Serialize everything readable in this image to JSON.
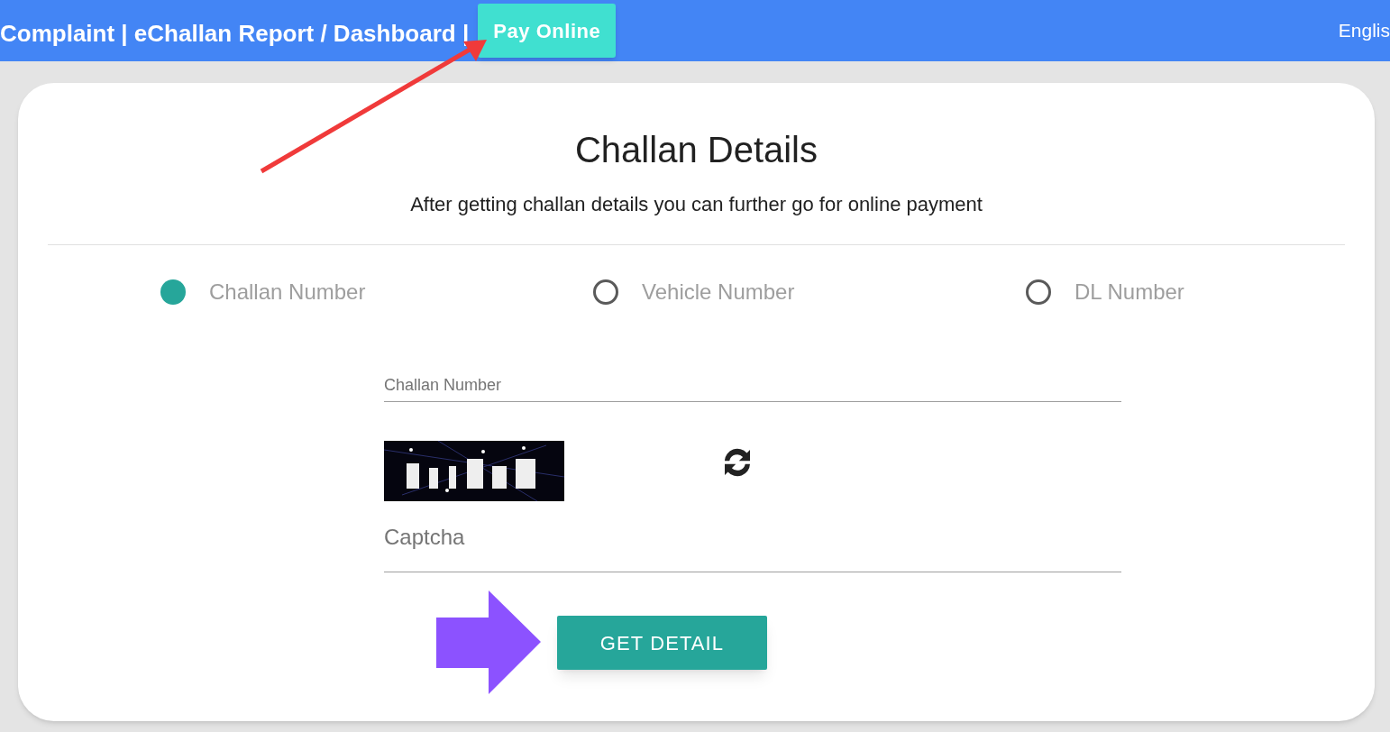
{
  "top_bar": {
    "breadcrumb": "Complaint | eChallan Report / Dashboard |",
    "pay_button": "Pay Online",
    "language": "Englis"
  },
  "card": {
    "title": "Challan Details",
    "subtitle": "After getting challan details you can further go for online payment",
    "search_options": [
      {
        "label": "Challan Number",
        "selected": true
      },
      {
        "label": "Vehicle Number",
        "selected": false
      },
      {
        "label": "DL Number",
        "selected": false
      }
    ],
    "number_field": {
      "placeholder": "Challan Number"
    },
    "captcha_field": {
      "placeholder": "Captcha"
    },
    "submit_button": "GET DETAIL"
  }
}
